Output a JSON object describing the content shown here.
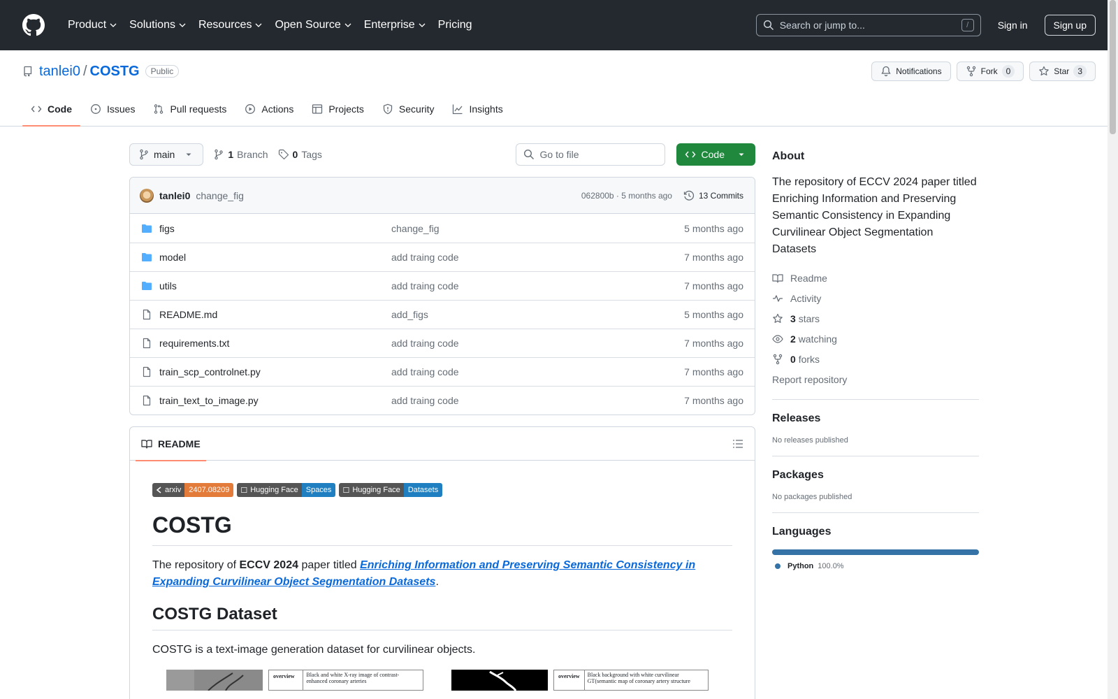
{
  "header": {
    "nav": [
      "Product",
      "Solutions",
      "Resources",
      "Open Source",
      "Enterprise",
      "Pricing"
    ],
    "search_placeholder": "Search or jump to...",
    "search_shortcut": "/",
    "sign_in": "Sign in",
    "sign_up": "Sign up"
  },
  "repo": {
    "owner": "tanlei0",
    "separator": "/",
    "name": "COSTG",
    "visibility": "Public",
    "notifications_label": "Notifications",
    "fork_label": "Fork",
    "fork_count": "0",
    "star_label": "Star",
    "star_count": "3"
  },
  "tabs": [
    {
      "label": "Code",
      "icon": "code-icon"
    },
    {
      "label": "Issues",
      "icon": "issue-icon"
    },
    {
      "label": "Pull requests",
      "icon": "pull-request-icon"
    },
    {
      "label": "Actions",
      "icon": "play-icon"
    },
    {
      "label": "Projects",
      "icon": "table-icon"
    },
    {
      "label": "Security",
      "icon": "shield-icon"
    },
    {
      "label": "Insights",
      "icon": "graph-icon"
    }
  ],
  "filebar": {
    "branch": "main",
    "branch_count": "1",
    "branch_label": "Branch",
    "tag_count": "0",
    "tag_label": "Tags",
    "goto_placeholder": "Go to file",
    "code_button": "Code"
  },
  "commit": {
    "author": "tanlei0",
    "message": "change_fig",
    "meta": "062800b · 5 months ago",
    "commits_label": "13 Commits"
  },
  "files": [
    {
      "name": "figs",
      "type": "dir",
      "message": "change_fig",
      "age": "5 months ago"
    },
    {
      "name": "model",
      "type": "dir",
      "message": "add traing code",
      "age": "7 months ago"
    },
    {
      "name": "utils",
      "type": "dir",
      "message": "add traing code",
      "age": "7 months ago"
    },
    {
      "name": "README.md",
      "type": "file",
      "message": "add_figs",
      "age": "5 months ago"
    },
    {
      "name": "requirements.txt",
      "type": "file",
      "message": "add traing code",
      "age": "7 months ago"
    },
    {
      "name": "train_scp_controlnet.py",
      "type": "file",
      "message": "add traing code",
      "age": "7 months ago"
    },
    {
      "name": "train_text_to_image.py",
      "type": "file",
      "message": "add traing code",
      "age": "7 months ago"
    }
  ],
  "readme": {
    "tab_label": "README",
    "badges": [
      {
        "left": "arxiv",
        "right": "2407.08209",
        "color": "#e37b3a"
      },
      {
        "left": "Hugging Face",
        "right": "Spaces",
        "color": "#1f7fc1"
      },
      {
        "left": "Hugging Face",
        "right": "Datasets",
        "color": "#1f7fc1"
      }
    ],
    "title": "COSTG",
    "intro_prefix": "The repository of ",
    "intro_bold": "ECCV 2024",
    "intro_mid": " paper titled ",
    "intro_link": "Enriching Information and Preserving Semantic Consistency in Expanding Curvilinear Object Segmentation Datasets",
    "intro_suffix": ".",
    "dataset_heading": "COSTG Dataset",
    "dataset_text": "COSTG is a text-image generation dataset for curvilinear objects.",
    "fig1_key": "overview",
    "fig1_text": "Black and white X-ray image of contrast-enhanced coronary arteries",
    "fig2_key": "overview",
    "fig2_text": "Black background with white curvilinear GT(semantic map of coronary artery structure"
  },
  "about": {
    "heading": "About",
    "description": "The repository of ECCV 2024 paper titled Enriching Information and Preserving Semantic Consistency in Expanding Curvilinear Object Segmentation Datasets",
    "readme": "Readme",
    "activity": "Activity",
    "stars_count": "3",
    "stars_label": "stars",
    "watching_count": "2",
    "watching_label": "watching",
    "forks_count": "0",
    "forks_label": "forks",
    "report": "Report repository"
  },
  "releases": {
    "heading": "Releases",
    "text": "No releases published"
  },
  "packages": {
    "heading": "Packages",
    "text": "No packages published"
  },
  "languages": {
    "heading": "Languages",
    "name": "Python",
    "percent": "100.0%",
    "color": "#3572A5"
  }
}
